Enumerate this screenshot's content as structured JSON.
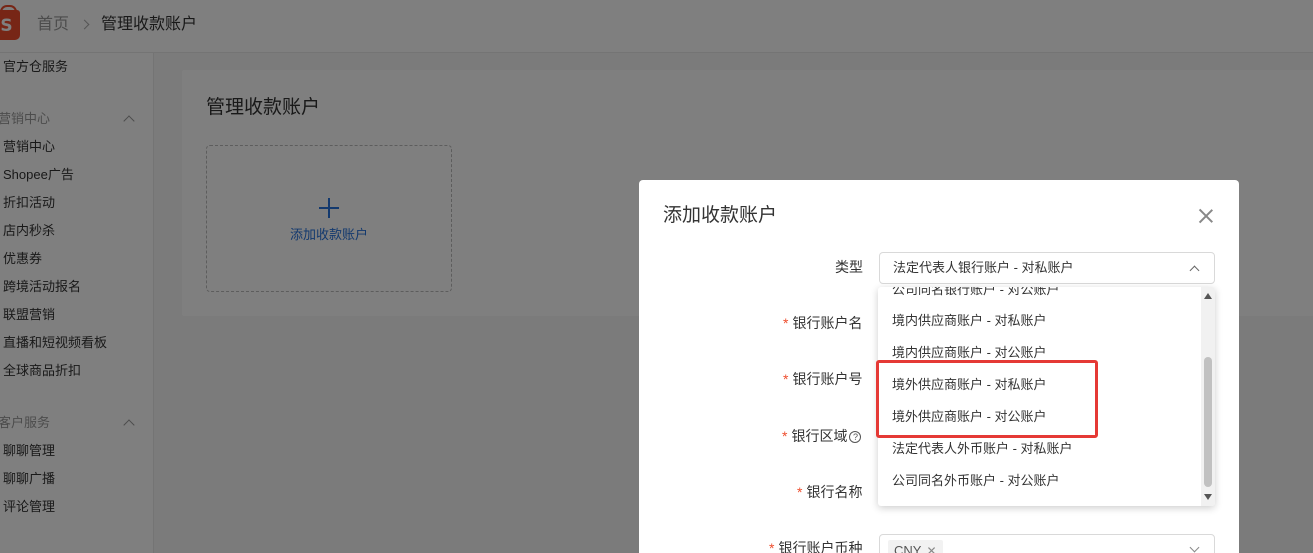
{
  "header": {
    "logo_letter": "S",
    "breadcrumb_home": "首页",
    "breadcrumb_current": "管理收款账户"
  },
  "sidebar": {
    "items": [
      {
        "label": "官方仓服务",
        "kind": "item"
      },
      {
        "label": "营销中心",
        "kind": "group"
      },
      {
        "label": "营销中心",
        "kind": "item"
      },
      {
        "label": "Shopee广告",
        "kind": "item"
      },
      {
        "label": "折扣活动",
        "kind": "item"
      },
      {
        "label": "店内秒杀",
        "kind": "item"
      },
      {
        "label": "优惠券",
        "kind": "item"
      },
      {
        "label": "跨境活动报名",
        "kind": "item"
      },
      {
        "label": "联盟营销",
        "kind": "item"
      },
      {
        "label": "直播和短视频看板",
        "kind": "item"
      },
      {
        "label": "全球商品折扣",
        "kind": "item"
      },
      {
        "label": "客户服务",
        "kind": "group"
      },
      {
        "label": "聊聊管理",
        "kind": "item"
      },
      {
        "label": "聊聊广播",
        "kind": "item"
      },
      {
        "label": "评论管理",
        "kind": "item"
      }
    ]
  },
  "main": {
    "title": "管理收款账户",
    "add_tile_label": "添加收款账户"
  },
  "modal": {
    "title": "添加收款账户",
    "fields": {
      "type_label": "类型",
      "type_value": "法定代表人银行账户 - 对私账户",
      "account_name_label": "银行账户名",
      "account_number_label": "银行账户号",
      "bank_region_label": "银行区域",
      "bank_name_label": "银行名称",
      "currency_label": "银行账户币种",
      "currency_value": "CNY",
      "required_mark": "*",
      "help_glyph": "?"
    },
    "dropdown_options": [
      "公司同名银行账户 - 对公账户",
      "境内供应商账户 - 对私账户",
      "境内供应商账户 - 对公账户",
      "境外供应商账户 - 对私账户",
      "境外供应商账户 - 对公账户",
      "法定代表人外币账户 - 对私账户",
      "公司同名外币账户 - 对公账户"
    ]
  },
  "colors": {
    "brand": "#ee4d2d",
    "link": "#2673dd",
    "highlight": "#e53935",
    "overlay": "rgba(0,0,0,0.5)"
  }
}
